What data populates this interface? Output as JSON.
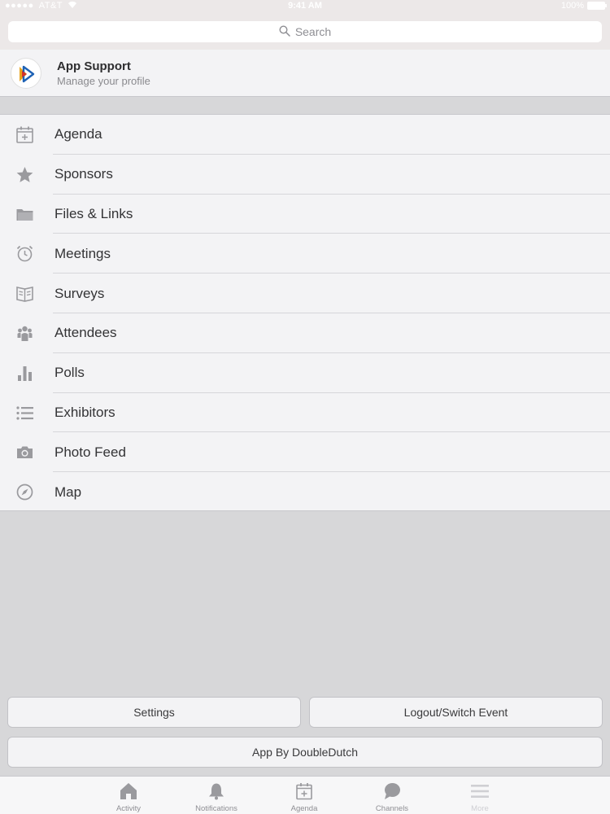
{
  "status_bar": {
    "carrier": "AT&T",
    "time": "9:41 AM",
    "battery": "100%"
  },
  "search": {
    "placeholder": "Search"
  },
  "profile": {
    "name": "App Support",
    "subtitle": "Manage your profile"
  },
  "menu": {
    "items": [
      {
        "label": "Agenda",
        "icon": "calendar-add-icon"
      },
      {
        "label": "Sponsors",
        "icon": "star-icon"
      },
      {
        "label": "Files & Links",
        "icon": "folder-icon"
      },
      {
        "label": "Meetings",
        "icon": "alarm-clock-icon"
      },
      {
        "label": "Surveys",
        "icon": "book-icon"
      },
      {
        "label": "Attendees",
        "icon": "people-icon"
      },
      {
        "label": "Polls",
        "icon": "bar-chart-icon"
      },
      {
        "label": "Exhibitors",
        "icon": "list-icon"
      },
      {
        "label": "Photo Feed",
        "icon": "camera-icon"
      },
      {
        "label": "Map",
        "icon": "compass-icon"
      }
    ]
  },
  "buttons": {
    "settings": "Settings",
    "logout": "Logout/Switch Event",
    "app_by": "App By DoubleDutch"
  },
  "tab_bar": {
    "tabs": [
      {
        "label": "Activity",
        "icon": "home-icon"
      },
      {
        "label": "Notifications",
        "icon": "bell-icon"
      },
      {
        "label": "Agenda",
        "icon": "calendar-add-icon"
      },
      {
        "label": "Channels",
        "icon": "chat-bubble-icon"
      },
      {
        "label": "More",
        "icon": "hamburger-icon"
      }
    ]
  },
  "colors": {
    "icon_gray": "#9a9a9e",
    "background": "#d7d7d9",
    "panel": "#f3f3f5"
  }
}
